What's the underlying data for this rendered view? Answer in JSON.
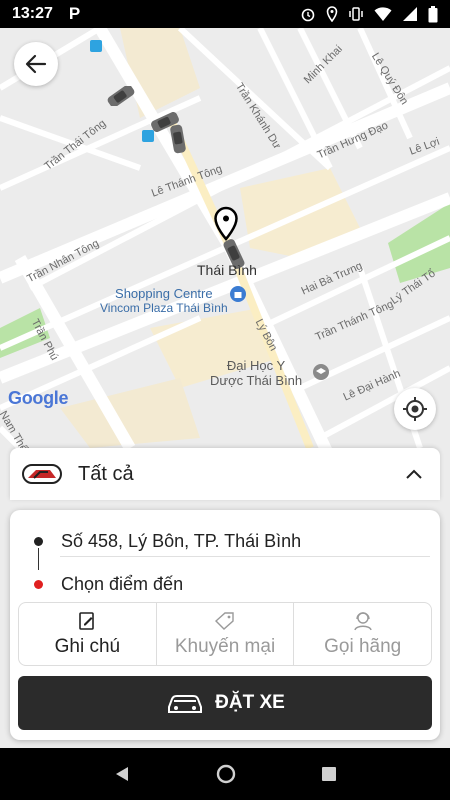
{
  "status_bar": {
    "time": "13:27",
    "app_badge": "P",
    "icons": [
      "alarm-icon",
      "location-icon",
      "vibrate-icon",
      "wifi-icon",
      "signal-icon",
      "battery-icon"
    ]
  },
  "map": {
    "streets": [
      "Trần Thái Tông",
      "Trần Khánh Dư",
      "Minh Khai",
      "Lê Quý Đôn",
      "Lê Thánh Tông",
      "Trần Hưng Đạo",
      "Lê Lợi",
      "Trần Nhân Tông",
      "Trần Phú",
      "Hai Bà Trưng",
      "Lý Thái Tổ",
      "Trần Thánh Tông",
      "Lý Bôn",
      "Lê Đại Hành",
      "Nam Thế Hiền"
    ],
    "pin_label": "Thái Bình",
    "poi_shopping": {
      "line1": "Shopping Centre",
      "line2": "Vincom Plaza Thái Bình"
    },
    "poi_university": {
      "line1": "Đại Học Y",
      "line2": "Dược Thái Bình"
    },
    "provider_logo": "Google",
    "colors": {
      "road_major": "#ffffff",
      "road_highlight": "#fbeec3",
      "park": "#b9e3a6",
      "background": "#ececec"
    }
  },
  "category": {
    "label": "Tất cả"
  },
  "trip": {
    "from_address": "Số 458, Lý Bôn, TP. Thái Bình",
    "to_placeholder": "Chọn điểm đến"
  },
  "options": [
    {
      "label": "Ghi chú",
      "icon": "note-edit-icon",
      "active": true
    },
    {
      "label": "Khuyến mại",
      "icon": "coupon-icon",
      "active": false
    },
    {
      "label": "Gọi hãng",
      "icon": "support-agent-icon",
      "active": false
    }
  ],
  "book_button": {
    "label": "ĐẶT XE",
    "icon": "car-icon"
  }
}
